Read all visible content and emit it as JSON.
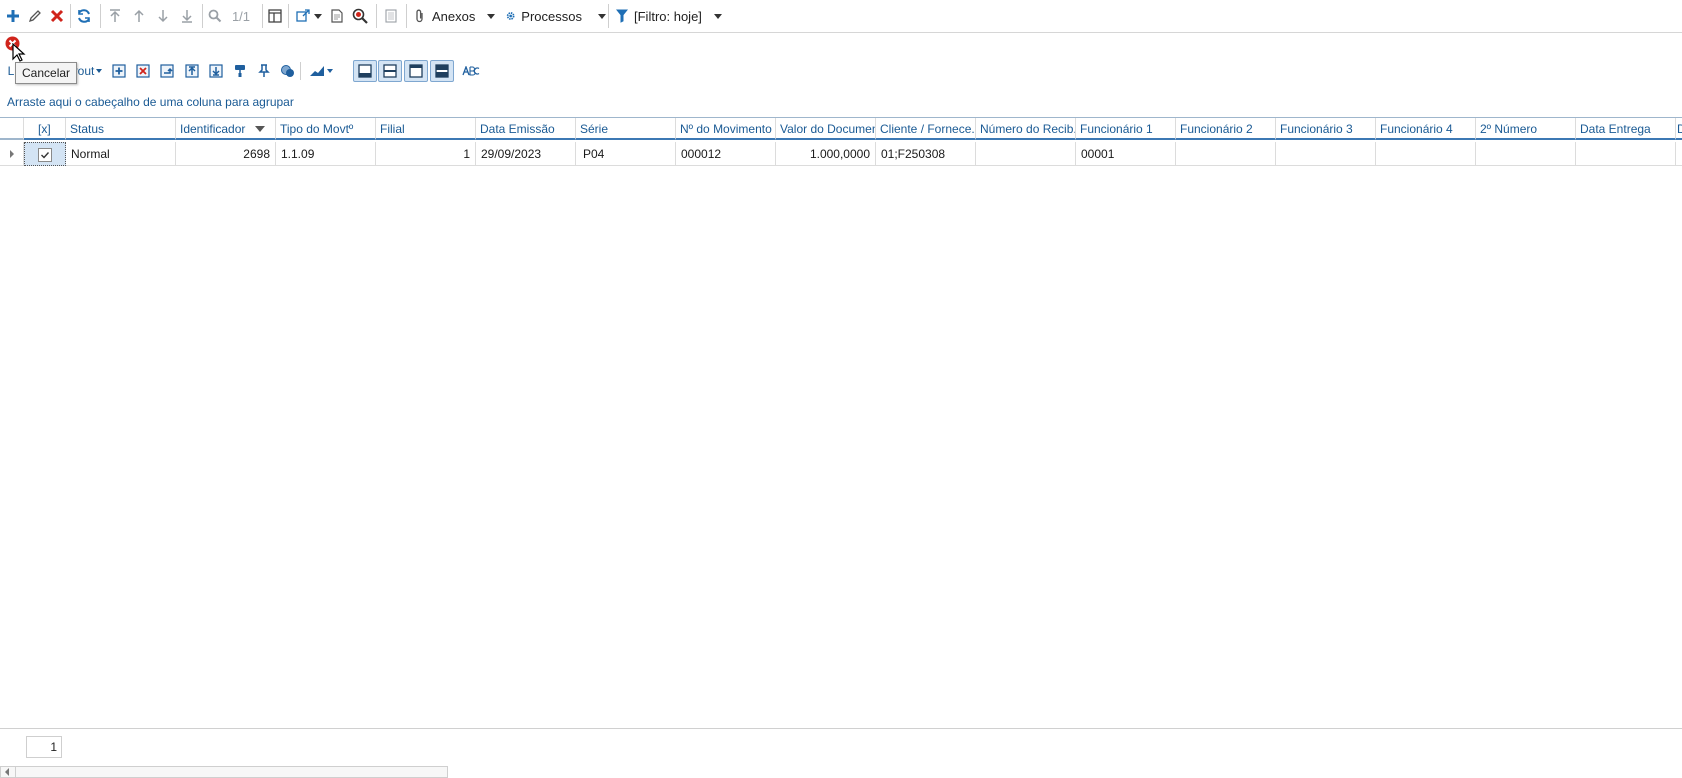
{
  "toolbar": {
    "page_indicator": "1/1",
    "anexos_label": "Anexos",
    "processos_label": "Processos",
    "filter_label": "[Filtro: hoje]"
  },
  "tooltip": {
    "text": "Cancelar"
  },
  "layout_menu": {
    "first_char": "L",
    "tail": "yout"
  },
  "group_hint": "Arraste aqui o cabeçalho de uma coluna para agrupar",
  "grid": {
    "columns": [
      {
        "label": "[x]"
      },
      {
        "label": "Status"
      },
      {
        "label": "Identificador"
      },
      {
        "label": "Tipo do Movtº"
      },
      {
        "label": "Filial"
      },
      {
        "label": "Data Emissão"
      },
      {
        "label": "Série"
      },
      {
        "label": "Nº do Movimento"
      },
      {
        "label": "Valor do Documen..."
      },
      {
        "label": "Cliente / Fornece..."
      },
      {
        "label": "Número do Recib..."
      },
      {
        "label": "Funcionário 1"
      },
      {
        "label": "Funcionário 2"
      },
      {
        "label": "Funcionário 3"
      },
      {
        "label": "Funcionário 4"
      },
      {
        "label": "2º Número"
      },
      {
        "label": "Data Entrega"
      },
      {
        "label": "D"
      }
    ],
    "rows": [
      {
        "checked": true,
        "status": "Normal",
        "identificador": "2698",
        "tipo": "1.1.09",
        "filial": "1",
        "data_emissao": "29/09/2023",
        "serie": "P04",
        "num_movimento": "000012",
        "valor": "1.000,0000",
        "cliente": "01;F250308",
        "numero_recibo": "",
        "func1": "00001",
        "func2": "",
        "func3": "",
        "func4": "",
        "segundo_numero": "",
        "data_entrega": ""
      }
    ]
  },
  "footer": {
    "page_number": "1"
  },
  "colors": {
    "accent_blue": "#1a5a94",
    "header_underline": "#3c78b4",
    "delete_red": "#d0241b",
    "selected_bg": "#d4e4f4"
  }
}
